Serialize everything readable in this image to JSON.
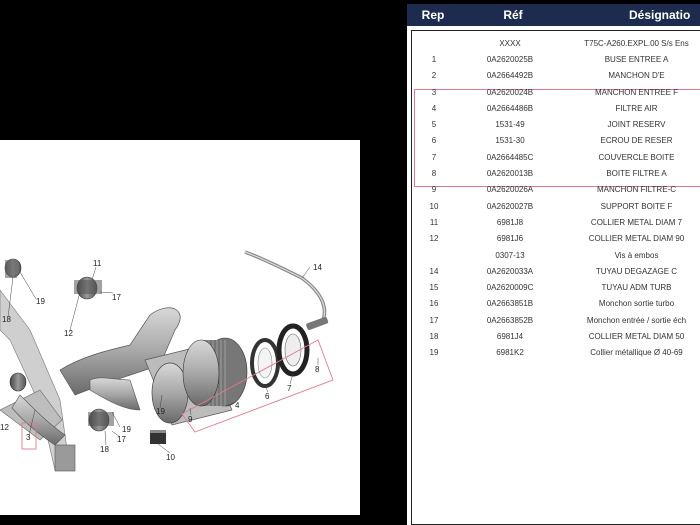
{
  "table": {
    "headers": {
      "rep": "Rep",
      "ref": "Réf",
      "designation": "Désignatio"
    },
    "rows": [
      {
        "rep": "",
        "ref": "XXXX",
        "designation": "T75C-A260.EXPL.00 S/s Ens"
      },
      {
        "rep": "1",
        "ref": "0A2620025B",
        "designation": "BUSE ENTREE A"
      },
      {
        "rep": "2",
        "ref": "0A2664492B",
        "designation": "MANCHON D'E"
      },
      {
        "rep": "3",
        "ref": "0A2620024B",
        "designation": "MANCHON ENTREE F"
      },
      {
        "rep": "4",
        "ref": "0A2664486B",
        "designation": "FILTRE AIR"
      },
      {
        "rep": "5",
        "ref": "1531-49",
        "designation": "JOINT RESERV"
      },
      {
        "rep": "6",
        "ref": "1531-30",
        "designation": "ECROU DE RESER"
      },
      {
        "rep": "7",
        "ref": "0A2664485C",
        "designation": "COUVERCLE BOITE"
      },
      {
        "rep": "8",
        "ref": "0A2620013B",
        "designation": "BOITE FILTRE A"
      },
      {
        "rep": "9",
        "ref": "0A2620026A",
        "designation": "MANCHON FILTRE-C"
      },
      {
        "rep": "10",
        "ref": "0A2620027B",
        "designation": "SUPPORT BOITE F"
      },
      {
        "rep": "11",
        "ref": "6981J8",
        "designation": "COLLIER METAL DIAM 7"
      },
      {
        "rep": "12",
        "ref": "6981J6",
        "designation": "COLLIER METAL DIAM 90"
      },
      {
        "rep": "",
        "ref": "0307-13",
        "designation": "Vis à embos"
      },
      {
        "rep": "14",
        "ref": "0A2620033A",
        "designation": "TUYAU DEGAZAGE C"
      },
      {
        "rep": "15",
        "ref": "0A2620009C",
        "designation": "TUYAU ADM TURB"
      },
      {
        "rep": "16",
        "ref": "0A2663851B",
        "designation": "Monchon sortie turbo"
      },
      {
        "rep": "17",
        "ref": "0A2663852B",
        "designation": "Monchon entrée / sortie éch"
      },
      {
        "rep": "18",
        "ref": "6981J4",
        "designation": "COLLIER METAL DIAM 50"
      },
      {
        "rep": "19",
        "ref": "6981K2",
        "designation": "Collier métallique Ø 40-69"
      }
    ]
  },
  "diagram": {
    "callouts": [
      "14",
      "11",
      "19",
      "18",
      "19",
      "12",
      "17",
      "3",
      "19",
      "18",
      "17",
      "12",
      "10",
      "19",
      "9",
      "4",
      "6",
      "7",
      "8",
      "2"
    ]
  }
}
